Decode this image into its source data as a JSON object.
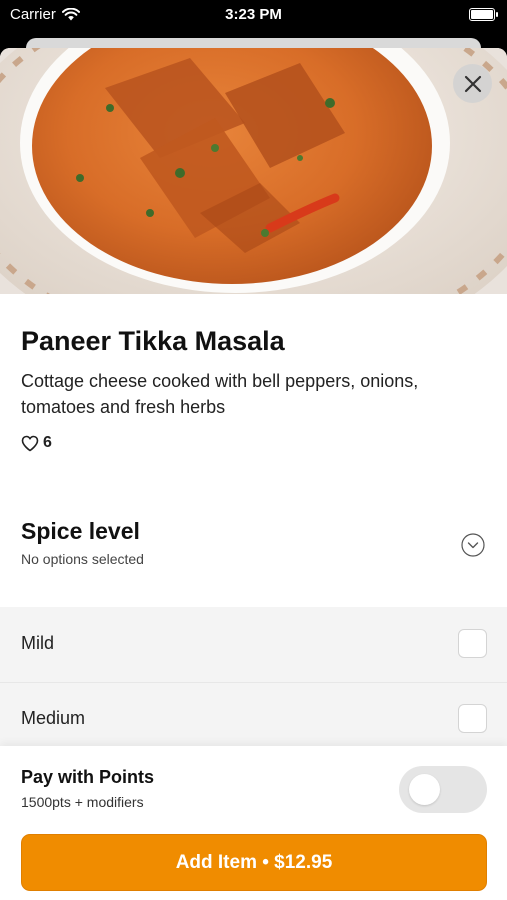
{
  "status_bar": {
    "carrier": "Carrier",
    "time": "3:23 PM",
    "wifi_icon": "wifi-icon",
    "battery_icon": "battery-icon"
  },
  "item": {
    "image_icon": "food-photo",
    "close_icon": "close-icon",
    "title": "Paneer Tikka Masala",
    "description": "Cottage cheese cooked with bell peppers, onions, tomatoes and fresh herbs",
    "likes_icon": "heart-icon",
    "likes": "6"
  },
  "spice_level": {
    "title": "Spice level",
    "subtitle": "No options selected",
    "expand_icon": "chevron-down-icon",
    "options": [
      {
        "label": "Mild",
        "checked": false
      },
      {
        "label": "Medium",
        "checked": false
      }
    ]
  },
  "footer": {
    "points_title": "Pay with Points",
    "points_subtitle": "1500pts + modifiers",
    "points_enabled": false,
    "add_button_label": "Add Item • $12.95"
  },
  "colors": {
    "accent": "#f08c00",
    "toggle_off": "#e5e5e5",
    "options_bg": "#f4f4f4"
  }
}
